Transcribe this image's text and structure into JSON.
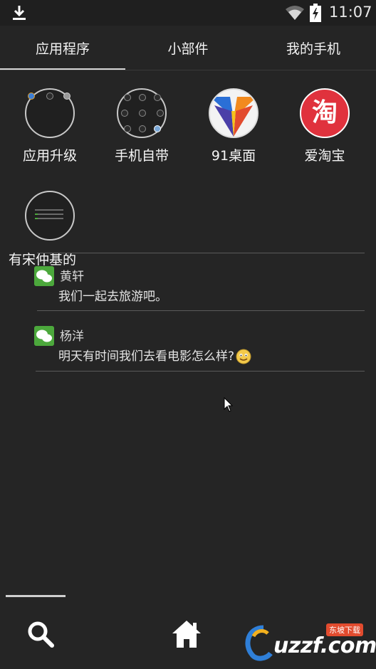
{
  "status_bar": {
    "time": "11:07"
  },
  "tabs": [
    {
      "label": "应用程序"
    },
    {
      "label": "小部件"
    },
    {
      "label": "我的手机"
    }
  ],
  "apps": [
    {
      "label": "应用升级",
      "icon": "folder-icon"
    },
    {
      "label": "手机自带",
      "icon": "folder-icon"
    },
    {
      "label": "91桌面",
      "icon": "91-desktop-icon"
    },
    {
      "label": "爱淘宝",
      "icon": "taobao-icon",
      "glyph": "淘"
    },
    {
      "label": "有宋仲基的",
      "icon": "folder-icon"
    }
  ],
  "messages": [
    {
      "sender": "黄轩",
      "text": "我们一起去旅游吧。",
      "icon": "wechat-icon"
    },
    {
      "sender": "杨洋",
      "text": "明天有时间我们去看电影怎么样?",
      "icon": "wechat-icon",
      "emoji": "smiley-icon"
    }
  ],
  "watermark": {
    "logo": "uzzf.com",
    "sub": "东坡下载"
  },
  "colors": {
    "background": "#252525",
    "taobao": "#e0323d",
    "wechat": "#4ca83c"
  }
}
